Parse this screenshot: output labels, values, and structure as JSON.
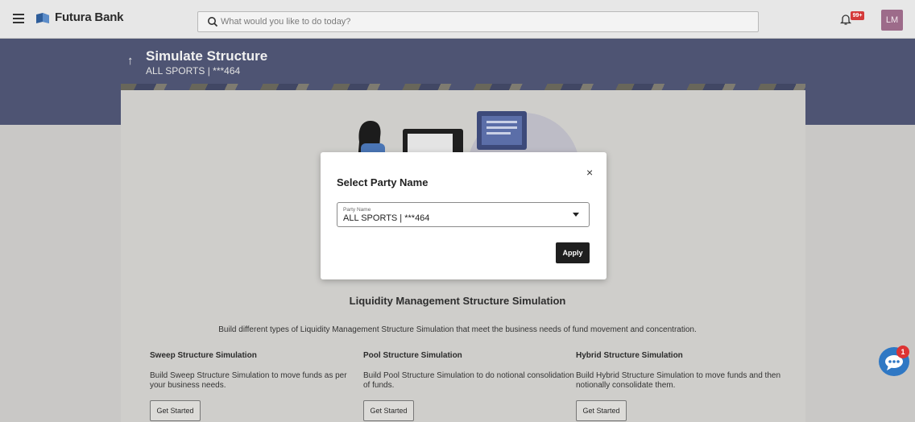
{
  "topbar": {
    "brand": "Futura Bank",
    "search_placeholder": "What would you like to do today?",
    "notification_badge": "99+",
    "avatar_initials": "LM"
  },
  "header": {
    "title": "Simulate Structure",
    "subtitle": "ALL SPORTS | ***464"
  },
  "main": {
    "title": "Liquidity Management Structure Simulation",
    "description": "Build different types of Liquidity Management Structure Simulation that meet the business needs of fund movement and concentration.",
    "options": [
      {
        "title": "Sweep Structure Simulation",
        "description": "Build Sweep Structure Simulation to move funds as per your business needs.",
        "button": "Get Started"
      },
      {
        "title": "Pool Structure Simulation",
        "description": "Build Pool Structure Simulation to do notional consolidation of funds.",
        "button": "Get Started"
      },
      {
        "title": "Hybrid Structure Simulation",
        "description": "Build Hybrid Structure Simulation to move funds and then notionally consolidate them.",
        "button": "Get Started"
      }
    ]
  },
  "chat": {
    "badge": "1"
  },
  "modal": {
    "title": "Select Party Name",
    "close_symbol": "×",
    "field_label": "Party Name",
    "field_value": "ALL SPORTS | ***464",
    "apply_label": "Apply"
  },
  "colors": {
    "header_band": "#4e5473",
    "accent_chat": "#2f78c4",
    "apply_button": "#1f1f1f",
    "overlay_bg": "#c9c8c6"
  }
}
